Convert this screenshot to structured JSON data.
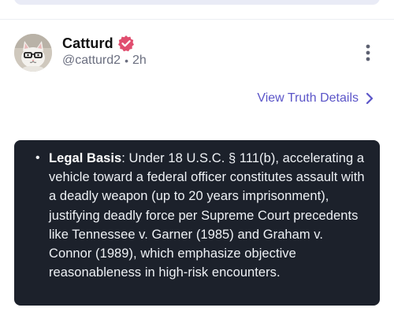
{
  "post": {
    "author": {
      "display_name": "Catturd",
      "handle": "@catturd2",
      "time_ago": "2h",
      "verified": true
    },
    "details_link_label": "View Truth Details",
    "content": {
      "bullet_label": "Legal Basis",
      "bullet_text": ": Under 18 U.S.C. § 111(b), accelerating a vehicle toward a federal officer constitutes assault with a deadly weapon (up to 20 years imprisonment), justifying deadly force per Supreme Court precedents like Tennessee v. Garner (1985) and Graham v. Connor (1989), which emphasize objective reasonableness in high-risk encounters."
    }
  },
  "icons": {
    "verified": "verified-badge-icon",
    "more": "more-vertical-icon",
    "chevron": "chevron-right-icon"
  },
  "colors": {
    "link": "#5b55c8",
    "verified_badge": "#e04e6f",
    "card_background": "#1c212b"
  }
}
